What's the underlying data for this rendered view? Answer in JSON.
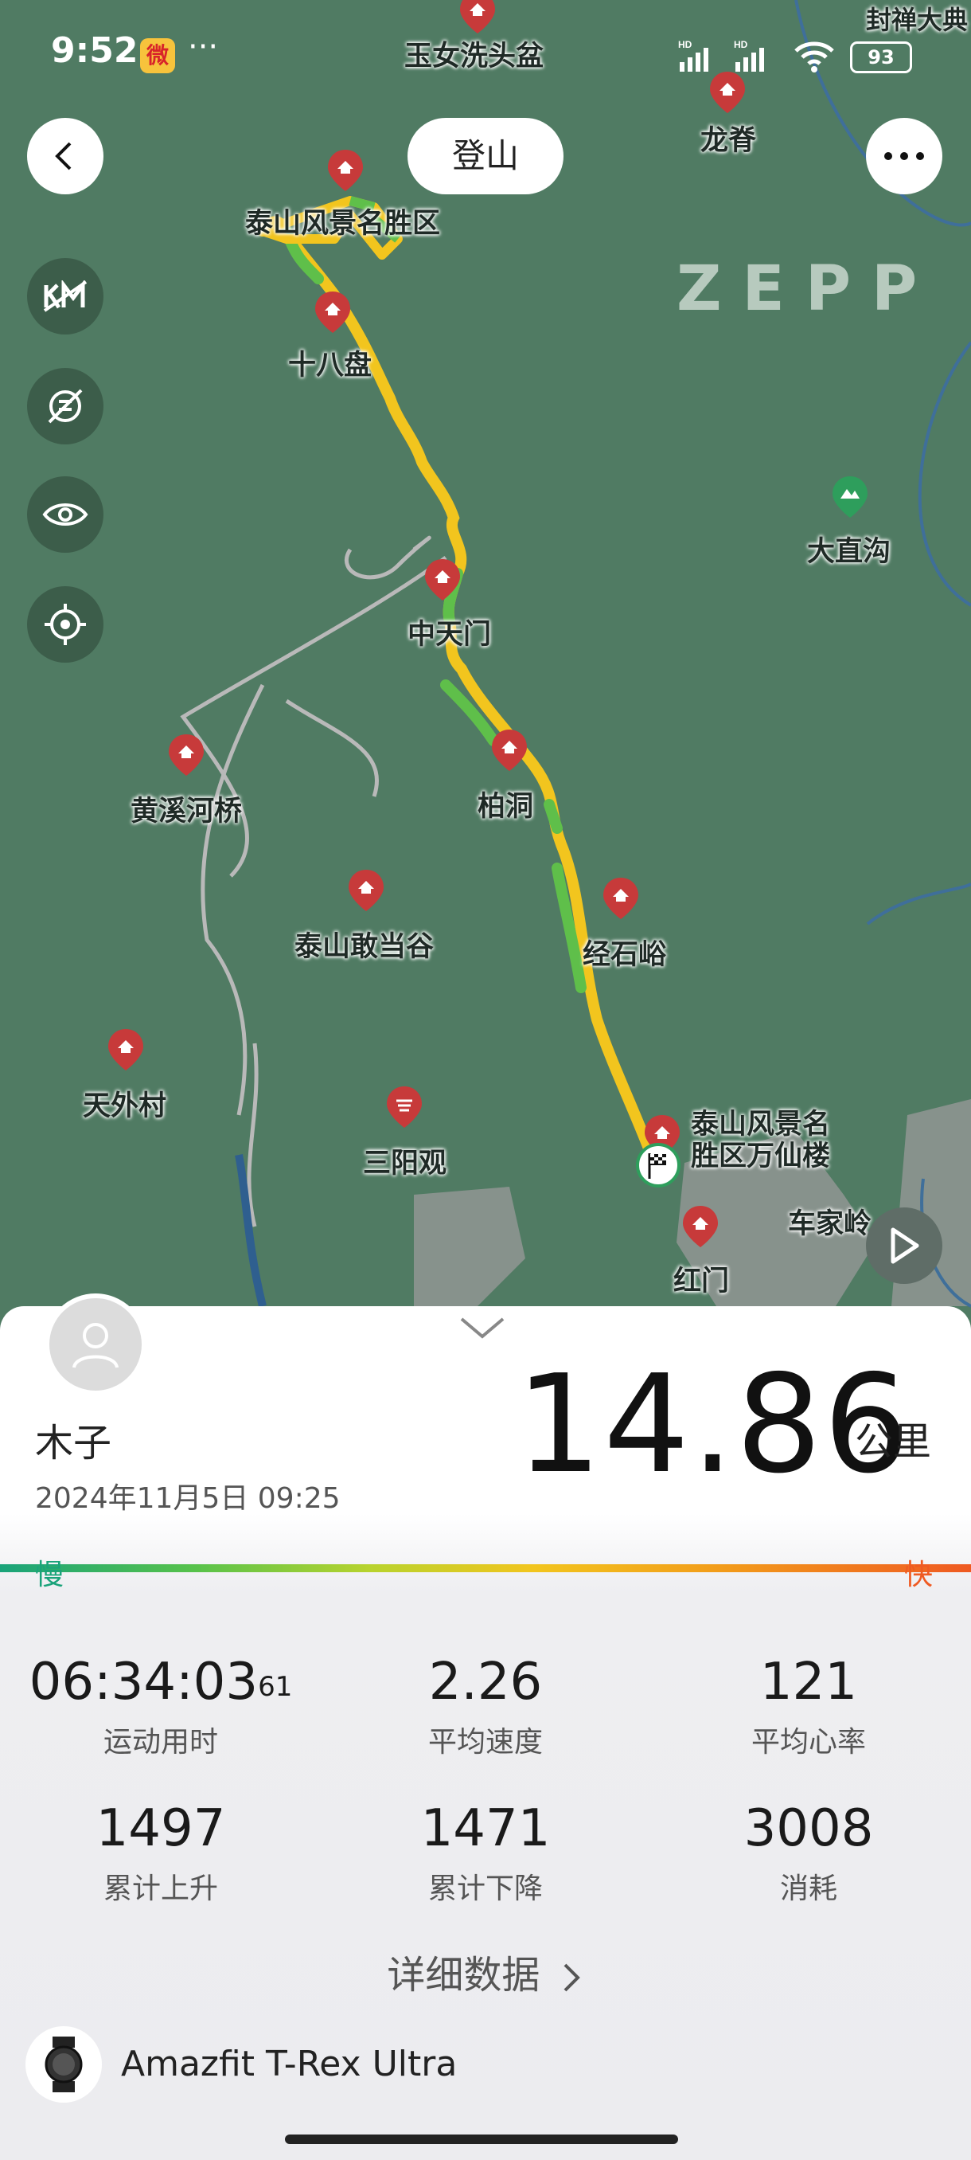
{
  "status_bar": {
    "time": "9:52",
    "battery": "93"
  },
  "header": {
    "title": "登山"
  },
  "map": {
    "watermark": "ZEPP",
    "labels": {
      "yunv": "玉女洗头盆",
      "fengchan": "封禅大典",
      "longji": "龙脊",
      "taishan_area": "泰山风景名胜区",
      "shibapan": "十八盘",
      "dazhigou": "大直沟",
      "zhongtianmen": "中天门",
      "huangxihe": "黄溪河桥",
      "baidong": "柏洞",
      "jingshiyu": "经石峪",
      "gandanggu": "泰山敢当谷",
      "tianwai": "天外村",
      "sanyang": "三阳观",
      "wanxianlou": "泰山风景名胜区万仙楼",
      "chejialing": "车家岭",
      "hongmen": "红门"
    }
  },
  "workout": {
    "user_name": "木子",
    "datetime": "2024年11月5日 09:25",
    "distance": "14.86",
    "distance_unit": "公里",
    "slow_label": "慢",
    "fast_label": "快",
    "stats": [
      {
        "value": "06:34:03",
        "sup": "61",
        "label": "运动用时"
      },
      {
        "value": "2.26",
        "label": "平均速度"
      },
      {
        "value": "121",
        "label": "平均心率"
      },
      {
        "value": "1497",
        "label": "累计上升"
      },
      {
        "value": "1471",
        "label": "累计下降"
      },
      {
        "value": "3008",
        "label": "消耗"
      }
    ],
    "detail_link": "详细数据",
    "device_name": "Amazfit T-Rex Ultra"
  },
  "colors": {
    "map_bg": "#507b63",
    "route_fast": "#f2c51e",
    "route_slow": "#5fbf4a",
    "slow": "#1aa37a",
    "fast": "#ef5a22"
  }
}
